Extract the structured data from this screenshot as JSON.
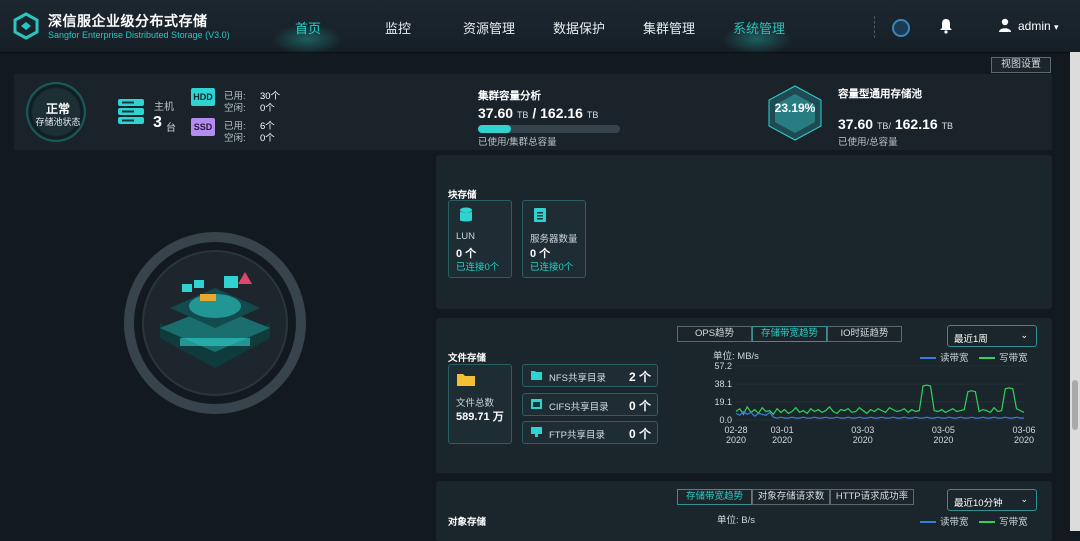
{
  "brand": {
    "title": "深信服企业级分布式存储",
    "subtitle": "Sangfor Enterprise Distributed Storage (V3.0)"
  },
  "nav": {
    "items": [
      {
        "label": "首页",
        "active": true
      },
      {
        "label": "监控"
      },
      {
        "label": "资源管理"
      },
      {
        "label": "数据保护"
      },
      {
        "label": "集群管理"
      },
      {
        "label": "系统管理",
        "highlight": true
      }
    ]
  },
  "user": {
    "name": "admin",
    "caret": "▾"
  },
  "view_settings": "视图设置",
  "status": {
    "state": "正常",
    "label": "存储池状态"
  },
  "hosts": {
    "label": "主机",
    "count": "3",
    "unit": "台"
  },
  "hdd": {
    "badge": "HDD",
    "used_label": "已用:",
    "used": "30个",
    "free_label": "空闲:",
    "free": "0个"
  },
  "ssd": {
    "badge": "SSD",
    "used_label": "已用:",
    "used": "6个",
    "free_label": "空闲:",
    "free": "0个"
  },
  "cluster_capacity": {
    "title": "集群容量分析",
    "used": "37.60",
    "used_unit": "TB",
    "sep": "/",
    "total": "162.16",
    "total_unit": "TB",
    "caption": "已使用/集群总容量",
    "fraction": 0.2319
  },
  "pool": {
    "title": "容量型通用存储池",
    "percent": "23.19%",
    "used": "37.60",
    "used_unit": "TB/",
    "total": "162.16",
    "total_unit": "TB",
    "caption": "已使用/总容量"
  },
  "block_storage": {
    "title": "块存储",
    "lun": {
      "name": "LUN",
      "value": "0 个",
      "link": "已连接0个"
    },
    "servers": {
      "name": "服务器数量",
      "value": "0 个",
      "link": "已连接0个"
    }
  },
  "file_storage": {
    "title": "文件存储",
    "total": {
      "name": "文件总数",
      "value": "589.71 万"
    },
    "shares": [
      {
        "label": "NFS共享目录",
        "value": "2 个"
      },
      {
        "label": "CIFS共享目录",
        "value": "0 个"
      },
      {
        "label": "FTP共享目录",
        "value": "0 个"
      }
    ]
  },
  "file_chart": {
    "tabs": [
      "OPS趋势",
      "存储带宽趋势",
      "IO时延趋势"
    ],
    "active_tab": 1,
    "range": "最近1周",
    "unit": "单位:  MB/s",
    "legend": {
      "read": "读带宽",
      "write": "写带宽"
    },
    "colors": {
      "read": "#3a7fd5",
      "write": "#2fd35a"
    }
  },
  "object_storage": {
    "title": "对象存储",
    "tabs": [
      "存储带宽趋势",
      "对象存储请求数",
      "HTTP请求成功率"
    ],
    "range": "最近10分钟",
    "unit": "单位:  B/s",
    "legend": {
      "read": "读带宽",
      "write": "写带宽"
    }
  },
  "chart_data": {
    "type": "line",
    "ylim": [
      0,
      57.2
    ],
    "yticks": [
      "57.2",
      "38.1",
      "19.1",
      "0.0"
    ],
    "xticks": [
      {
        "date": "02-28",
        "year": "2020"
      },
      {
        "date": "03-01",
        "year": "2020"
      },
      {
        "date": "03-03",
        "year": "2020"
      },
      {
        "date": "03-05",
        "year": "2020"
      },
      {
        "date": "03-06",
        "year": "2020"
      }
    ],
    "series": [
      {
        "name": "写带宽",
        "values": [
          9,
          12,
          6,
          14,
          8,
          11,
          7,
          13,
          9,
          10,
          6,
          12,
          8,
          11,
          7,
          9,
          13,
          8,
          10,
          7,
          12,
          9,
          11,
          8,
          10,
          14,
          9,
          7,
          11,
          10,
          12,
          8,
          9,
          13,
          10,
          7,
          11,
          9,
          12,
          10,
          8,
          13,
          11,
          9,
          10,
          12,
          8,
          11,
          9,
          10,
          36,
          37,
          36,
          10,
          9,
          11,
          8,
          10,
          12,
          9,
          10,
          11,
          30,
          31,
          30,
          9,
          11,
          10,
          8,
          13,
          9,
          10,
          33,
          34,
          33,
          12,
          10,
          8
        ]
      },
      {
        "name": "读带宽",
        "values": [
          7,
          5,
          9,
          6,
          8,
          4,
          7,
          6,
          5,
          8,
          3,
          2,
          3,
          2,
          2,
          3,
          2,
          2,
          3,
          2,
          2,
          3,
          2,
          2,
          3,
          2,
          2,
          3,
          2,
          2,
          3,
          2,
          2,
          3,
          2,
          2,
          3,
          2,
          2,
          3,
          2,
          2,
          3,
          2,
          2,
          3,
          2,
          2,
          3,
          2,
          2,
          3,
          2,
          2,
          3,
          2,
          2,
          3,
          2,
          2,
          3,
          2,
          2,
          3,
          2,
          2,
          3,
          2,
          2,
          3,
          2,
          2,
          3,
          2,
          2,
          3,
          2,
          2
        ]
      }
    ]
  }
}
